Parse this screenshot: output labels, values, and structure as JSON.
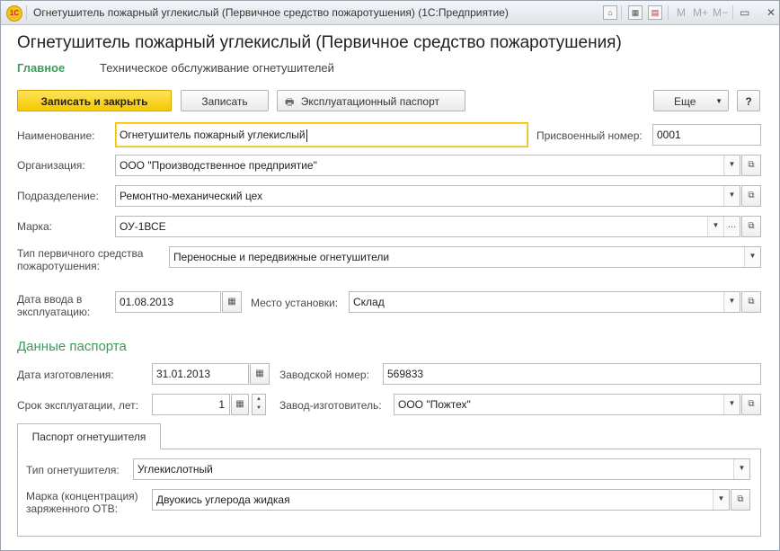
{
  "window": {
    "title": "Огнетушитель пожарный углекислый (Первичное средство пожаротушения)  (1С:Предприятие)",
    "app_icon": "1С",
    "toolbar_m": "M",
    "toolbar_mplus": "M+",
    "toolbar_mminus": "M−",
    "icons": [
      "home-icon",
      "calculator-icon",
      "calendar-icon",
      "minimize-icon",
      "restore-icon",
      "close-icon"
    ]
  },
  "form": {
    "title": "Огнетушитель пожарный углекислый (Первичное средство пожаротушения)",
    "nav": {
      "main": "Главное",
      "link": "Техническое обслуживание огнетушителей"
    },
    "buttons": {
      "save_close": "Записать и закрыть",
      "save": "Записать",
      "passport": "Эксплуатационный паспорт",
      "more": "Еще",
      "help": "?"
    },
    "fields": {
      "name_label": "Наименование:",
      "name_value": "Огнетушитель пожарный углекислый",
      "number_label": "Присвоенный номер:",
      "number_value": "0001",
      "org_label": "Организация:",
      "org_value": "ООО \"Производственное предприятие\"",
      "dept_label": "Подразделение:",
      "dept_value": "Ремонтно-механический цех",
      "brand_label": "Марка:",
      "brand_value": "ОУ-1ВСЕ",
      "type_label": "Тип первичного средства пожаротушения:",
      "type_value": "Переносные и передвижные огнетушители",
      "date_label": "Дата ввода в эксплуатацию:",
      "date_value": "01.08.2013",
      "place_label": "Место установки:",
      "place_value": "Склад"
    },
    "passport": {
      "section_title": "Данные паспорта",
      "mfg_date_label": "Дата изготовления:",
      "mfg_date_value": "31.01.2013",
      "serial_label": "Заводской номер:",
      "serial_value": "569833",
      "life_label": "Срок эксплуатации, лет:",
      "life_value": "1",
      "maker_label": "Завод-изготовитель:",
      "maker_value": "ООО \"Пожтех\""
    },
    "tab": {
      "label": "Паспорт огнетушителя",
      "ext_type_label": "Тип огнетушителя:",
      "ext_type_value": "Углекислотный",
      "agent_label": "Марка (концентрация) заряженного ОТВ:",
      "agent_value": "Двуокись углерода жидкая"
    }
  }
}
